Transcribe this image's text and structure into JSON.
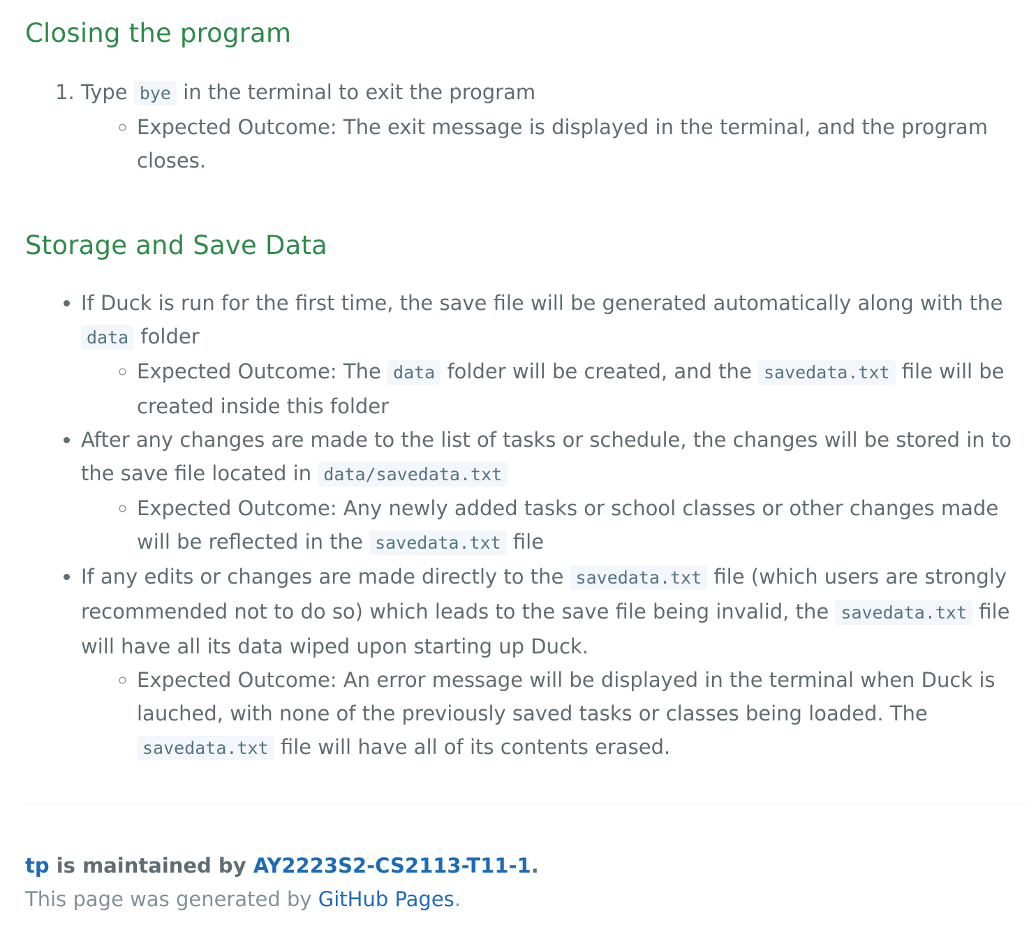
{
  "sections": {
    "closing": {
      "heading": "Closing the program",
      "step1": {
        "before": "Type ",
        "code": "bye",
        "after": " in the terminal to exit the program",
        "outcome": "Expected Outcome: The exit message is displayed in the terminal, and the program closes."
      }
    },
    "storage": {
      "heading": "Storage and Save Data",
      "item1": {
        "text_before": "If Duck is run for the first time, the save file will be generated automatically along with the ",
        "code": "data",
        "text_after": " folder",
        "outcome_before": "Expected Outcome: The ",
        "outcome_code1": "data",
        "outcome_mid": " folder will be created, and the ",
        "outcome_code2": "savedata.txt",
        "outcome_after": " file will be created inside this folder"
      },
      "item2": {
        "text_before": "After any changes are made to the list of tasks or schedule, the changes will be stored in to the save file located in ",
        "code": "data/savedata.txt",
        "outcome_before": "Expected Outcome: Any newly added tasks or school classes or other changes made will be reflected in the ",
        "outcome_code": "savedata.txt",
        "outcome_after": " file"
      },
      "item3": {
        "text_before": "If any edits or changes are made directly to the ",
        "code1": "savedata.txt",
        "text_mid": " file (which users are strongly recommended not to do so) which leads to the save file being invalid, the ",
        "code2": "savedata.txt",
        "text_after": " file will have all its data wiped upon starting up Duck.",
        "outcome_before": "Expected Outcome: An error message will be displayed in the terminal when Duck is lauched, with none of the previously saved tasks or classes being loaded. The ",
        "outcome_code": "savedata.txt",
        "outcome_after": " file will have all of its contents erased."
      }
    }
  },
  "footer": {
    "project_link": "tp",
    "maintained_by": " is maintained by ",
    "owner_link": "AY2223S2-CS2113-T11-1",
    "owner_period": ".",
    "credits_before": "This page was generated by ",
    "credits_link": "GitHub Pages",
    "credits_after": "."
  }
}
